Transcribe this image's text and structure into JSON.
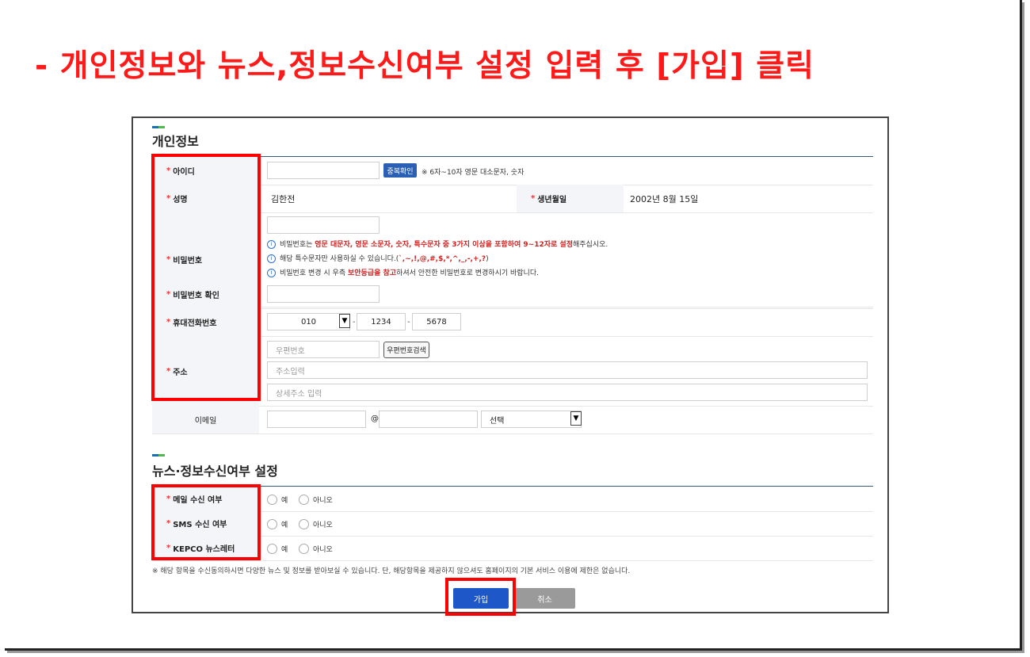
{
  "headline": "- 개인정보와 뉴스,정보수신여부 설정 입력 후 [가입] 클릭",
  "personal": {
    "title": "개인정보",
    "id_label": "아이디",
    "dup_check_button": "중복확인",
    "id_hint": "※ 6자~10자 영문 대소문자, 숫자",
    "name_label": "성명",
    "name_value": "김한전",
    "birth_label": "생년월일",
    "birth_value": "2002년 8월 15일",
    "password_label": "비밀번호",
    "pw_hint1_pre": "비밀번호는 ",
    "pw_hint1_red": "영문 대문자, 영문 소문자, 숫자, 특수문자 중 3가지 이상을 포함하여 9~12자로 설정",
    "pw_hint1_post": "해주십시오.",
    "pw_hint2_pre": "해당 특수문자만 사용하실 수 있습니다.(",
    "pw_hint2_red": "`,~,!,@,#,$,*,^,_,-,+,?",
    "pw_hint2_post": ")",
    "pw_hint3_pre": "비밀번호 변경 시 우측 ",
    "pw_hint3_red": "보안등급을 참고",
    "pw_hint3_post": "하셔서 안전한 비밀번호로 변경하시기 바랍니다.",
    "password_confirm_label": "비밀번호 확인",
    "phone_label": "휴대전화번호",
    "phone_prefix": "010",
    "phone_mid": "1234",
    "phone_last": "5678",
    "address_label": "주소",
    "zip_placeholder": "우편번호",
    "zip_search_button": "우편번호검색",
    "addr_placeholder": "주소입력",
    "addr_detail_placeholder": "상세주소 입력",
    "email_label": "이메일",
    "email_at": "@",
    "email_domain_select": "선택"
  },
  "news": {
    "title": "뉴스·정보수신여부 설정",
    "rows": [
      {
        "label": "메일 수신 여부",
        "yes": "예",
        "no": "아니오"
      },
      {
        "label": "SMS 수신 여부",
        "yes": "예",
        "no": "아니오"
      },
      {
        "label": "KEPCO 뉴스레터",
        "yes": "예",
        "no": "아니오"
      }
    ],
    "note": "※ 해당 항목을 수신동의하시면 다양한 뉴스 및 정보를 받아보실 수 있습니다. 단, 해당항목을 제공하지 않으셔도 홈페이지의 기본 서비스 이용에 제한은 없습니다."
  },
  "buttons": {
    "join": "가입",
    "cancel": "취소"
  },
  "colors": {
    "highlight": "#ff0000",
    "headline": "#ff1a1a",
    "primary_button": "#1e58c8",
    "required_mark": "#e33333"
  }
}
